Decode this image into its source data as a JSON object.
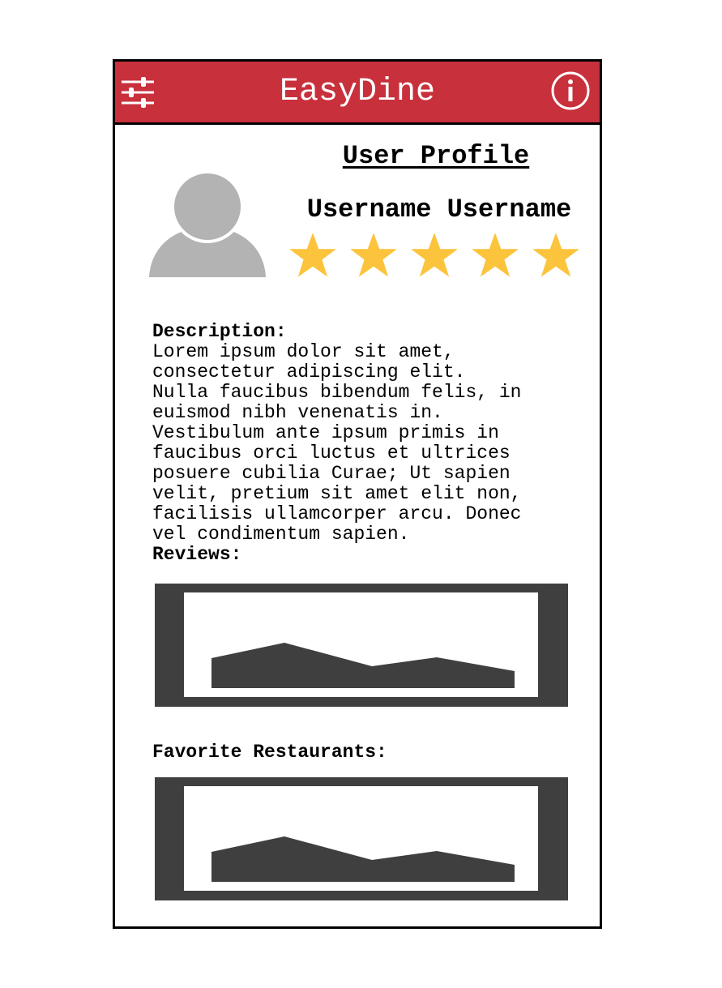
{
  "header": {
    "title": "EasyDine",
    "left_icon": "sliders-icon",
    "right_icon": "info-icon",
    "color": "#c8303c"
  },
  "profile": {
    "title": "User Profile",
    "username": "Username Username",
    "avatar_icon": "user-avatar-icon",
    "rating": {
      "value": 5,
      "max": 5,
      "star_color": "#fcc43c"
    }
  },
  "description": {
    "label": "Description:",
    "text": "Lorem ipsum dolor sit amet,\nconsectetur adipiscing elit.\nNulla faucibus bibendum felis, in\neuismod nibh venenatis in.\nVestibulum ante ipsum primis in\nfaucibus orci luctus et ultrices\nposuere cubilia Curae; Ut sapien\nvelit, pretium sit amet elit non,\nfacilisis ullamcorper arcu. Donec\nvel condimentum sapien."
  },
  "reviews": {
    "label": "Reviews:",
    "image_icon": "image-placeholder-icon"
  },
  "favorites": {
    "label": "Favorite Restaurants:",
    "image_icon": "image-placeholder-icon"
  },
  "colors": {
    "placeholder": "#3f3f3f",
    "avatar": "#b3b3b3"
  }
}
